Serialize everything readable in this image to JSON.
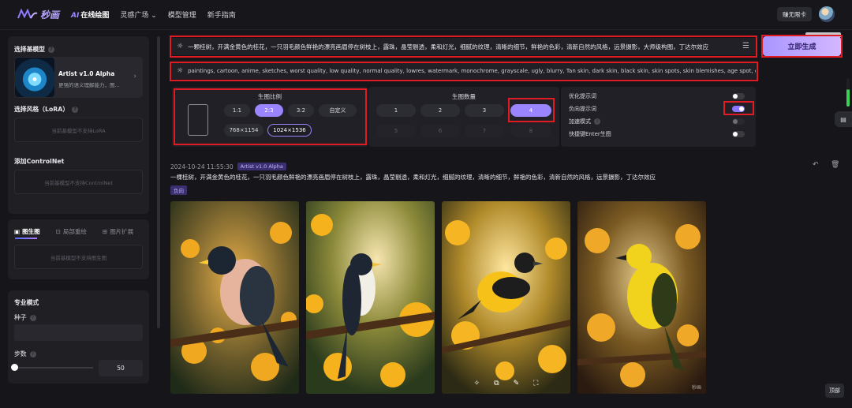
{
  "app": {
    "logo_text": "秒画"
  },
  "nav": {
    "ai_prefix": "AI",
    "items": [
      "在线绘图",
      "灵感广场",
      "模型管理",
      "新手指南"
    ]
  },
  "header": {
    "free_card": "赚无限卡"
  },
  "sidebar": {
    "base_model_title": "选择基模型",
    "model_name": "Artist v1.0 Alpha",
    "model_desc": "更强的语义理解能力，图...",
    "lora_title": "选择风格（LoRA）",
    "lora_disabled": "当前基模型不支持LoRA",
    "controlnet_title": "添加ControlNet",
    "controlnet_disabled": "当前基模型不支持ControlNet",
    "tabs": [
      "图生图",
      "局部重绘",
      "图片扩展"
    ],
    "img2img_disabled": "当前基模型不支持图生图",
    "pro_title": "专业模式",
    "seed_label": "种子",
    "steps_label": "步数",
    "steps_value": "50",
    "steps_fraction": 0.0
  },
  "prompt": {
    "positive": "一颗桂树，开满金黄色的桂花，一只羽毛颜色鲜艳的漂亮画眉停在树枝上，露珠，晶莹剔透，柔和灯光，细腻的纹理，清晰的细节，鲜艳的色彩，清新自然的风格，远景摄影，大师级构图，丁达尔效应",
    "negative": "paintings, cartoon, anime, sketches, worst quality, low quality, normal quality, lowres, watermark, monochrome, grayscale, ugly, blurry, Tan skin, dark skin, black skin, skin spots, skin blemishes, age spot, glans, d"
  },
  "generate_button": "立即生成",
  "ratio": {
    "title": "生图比例",
    "options": [
      "1:1",
      "2:3",
      "3:2",
      "自定义"
    ],
    "selected": "2:3",
    "sizes": [
      "768×1154",
      "1024×1536"
    ],
    "selected_size": "1024×1536"
  },
  "count": {
    "title": "生图数量",
    "options": [
      "1",
      "2",
      "3",
      "4",
      "5",
      "6",
      "7",
      "8"
    ],
    "selected": "4"
  },
  "options": [
    {
      "label": "优化提示词",
      "on": false
    },
    {
      "label": "负向提示词",
      "on": true
    },
    {
      "label": "加速模式",
      "on": false
    },
    {
      "label": "快捷键Enter生图",
      "on": false
    }
  ],
  "result": {
    "timestamp": "2024-10-24 11:55:30",
    "model_badge": "Artist v1.0 Alpha",
    "caption": "一棵桂树，开满金黄色的桂花，一只羽毛颜色鲜艳的漂亮画眉停在树枝上，露珠，晶莹剔透，柔和灯光，细腻的纹理，清晰的细节，鲜艳的色彩，清新自然的风格，远景摄影，丁达尔效应",
    "negative_badge": "负向",
    "watermark": "秒画",
    "top_button": "顶部"
  },
  "colors": {
    "accent": "#9a85ff",
    "highlight": "#e01b24",
    "bg": "#16161a"
  }
}
